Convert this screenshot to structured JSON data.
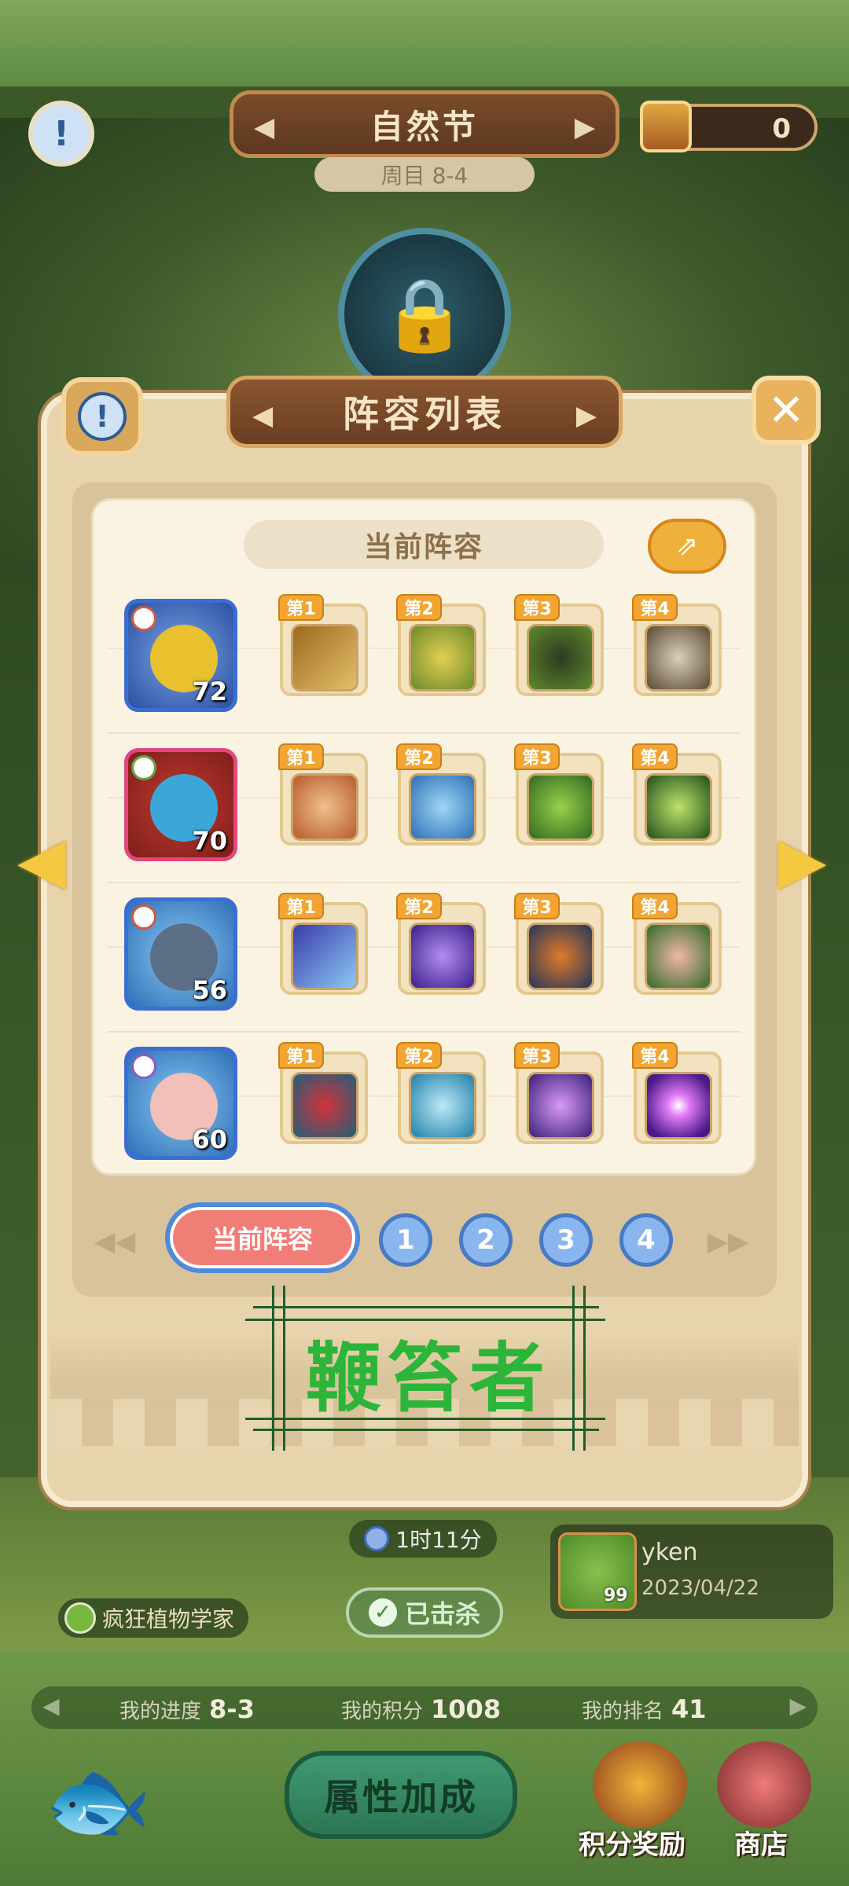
{
  "top": {
    "banner_title": "自然节",
    "week_label": "周目 8-4",
    "currency_value": "0"
  },
  "panel": {
    "title": "阵容列表",
    "header": "当前阵容",
    "stamp_text": "鞭笞者"
  },
  "rows": [
    {
      "level": "72",
      "hero_color": "#e9c12e",
      "slots": [
        "第1",
        "第2",
        "第3",
        "第4"
      ]
    },
    {
      "level": "70",
      "hero_color": "#3aa7d8",
      "slots": [
        "第1",
        "第2",
        "第3",
        "第4"
      ]
    },
    {
      "level": "56",
      "hero_color": "#5c6f86",
      "slots": [
        "第1",
        "第2",
        "第3",
        "第4"
      ]
    },
    {
      "level": "60",
      "hero_color": "#f1c0b8",
      "slots": [
        "第1",
        "第2",
        "第3",
        "第4"
      ]
    }
  ],
  "tabs": {
    "current": "当前阵容",
    "numbers": [
      "1",
      "2",
      "3",
      "4"
    ]
  },
  "status": {
    "timer": "1时11分",
    "plant_name": "疯狂植物学家",
    "killed": "已击杀",
    "record_name": "yken",
    "record_level": "99",
    "record_date": "2023/04/22"
  },
  "progress": {
    "my_progress_label": "我的进度",
    "my_progress_value": "8-3",
    "my_score_label": "我的积分",
    "my_score_value": "1008",
    "my_rank_label": "我的排名",
    "my_rank_value": "41"
  },
  "bottom": {
    "attr_button": "属性加成",
    "score_reward": "积分奖励",
    "shop": "商店"
  },
  "icons": [
    "info-icon",
    "close-icon",
    "share-icon",
    "lock-icon",
    "clock-icon",
    "check-icon",
    "fish-icon",
    "chest-icon",
    "shop-icon",
    "arrow-left-icon",
    "arrow-right-icon"
  ]
}
